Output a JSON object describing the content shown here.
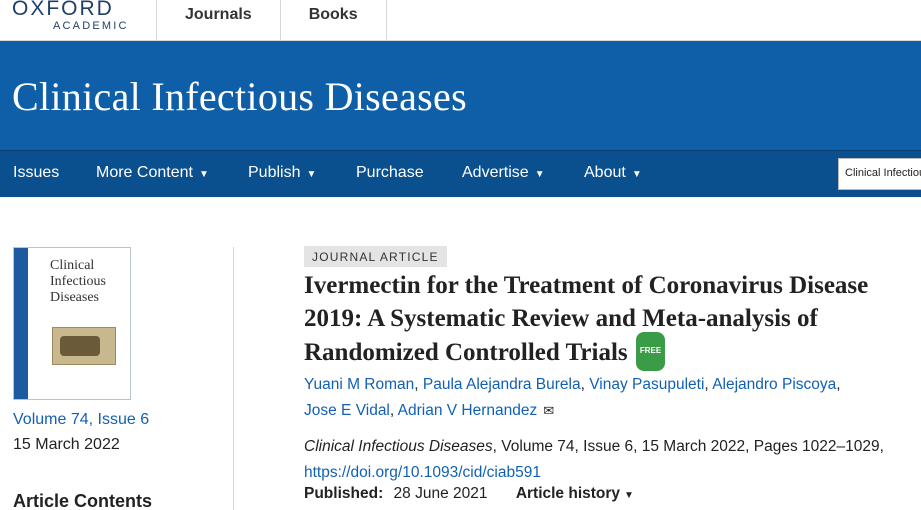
{
  "top": {
    "logo_main": "OXFORD",
    "logo_sub": "ACADEMIC",
    "nav": [
      "Journals",
      "Books"
    ]
  },
  "journal": {
    "title": "Clinical Infectious Diseases"
  },
  "navbar": {
    "items": [
      "Issues",
      "More Content",
      "Publish",
      "Purchase",
      "Advertise",
      "About"
    ],
    "caret": "▼",
    "search_value": "Clinical Infectious Diseases"
  },
  "sidebar": {
    "cover_title": "Clinical Infectious Diseases",
    "volume": "Volume 74, Issue 6",
    "date": "15 March 2022",
    "contents_heading": "Article Contents"
  },
  "article": {
    "type": "JOURNAL ARTICLE",
    "title": "Ivermectin for the Treatment of Coronavirus Disease 2019: A Systematic Review and Meta-analysis of Randomized Controlled Trials",
    "free_badge": "FREE",
    "authors": [
      "Yuani M Roman",
      "Paula Alejandra Burela",
      "Vinay Pasupuleti",
      "Alejandro Piscoya",
      "Jose E Vidal",
      "Adrian V Hernandez"
    ],
    "citation_journal": "Clinical Infectious Diseases",
    "citation_rest": ", Volume 74, Issue 6, 15 March 2022, Pages 1022–1029,",
    "doi": "https://doi.org/10.1093/cid/ciab591",
    "published_label": "Published:",
    "published_date": "28 June 2021",
    "history_label": "Article history"
  },
  "colors": {
    "banner": "#0f5fa8",
    "navbar": "#0a4f8e",
    "link": "#1260b4",
    "free_badge": "#3a9c46"
  },
  "icons": [
    "envelope-icon",
    "caret-down-icon"
  ]
}
